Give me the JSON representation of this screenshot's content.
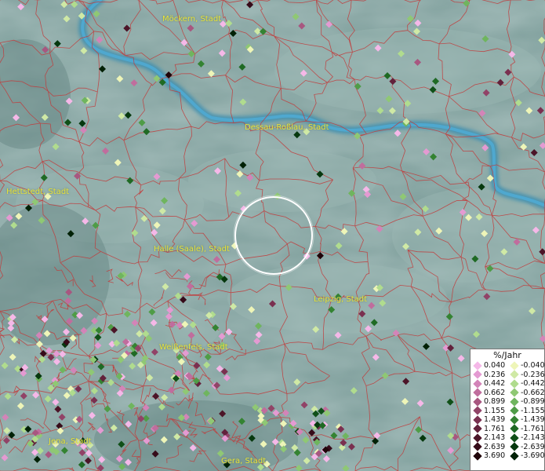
{
  "map": {
    "cities": [
      "Möckern, Stadt",
      "Dessau-Roßlau, Stadt",
      "Hettstedt, Stadt",
      "Halle (Saale), Stadt",
      "Leipzig, Stadt",
      "Weißenfels, Stadt",
      "Jena, Stadt",
      "Gera, Stadt"
    ],
    "legend": {
      "title": "%/Jahr",
      "positive": [
        {
          "label": "0.040",
          "color": "#f5b8e8"
        },
        {
          "label": "0.236",
          "color": "#e49ad2"
        },
        {
          "label": "0.442",
          "color": "#d384b8"
        },
        {
          "label": "0.662",
          "color": "#c06d9d"
        },
        {
          "label": "0.899",
          "color": "#a85780"
        },
        {
          "label": "1.155",
          "color": "#914367"
        },
        {
          "label": "1.439",
          "color": "#7a3050"
        },
        {
          "label": "1.761",
          "color": "#62213b"
        },
        {
          "label": "2.143",
          "color": "#4c1528"
        },
        {
          "label": "2.639",
          "color": "#360b19"
        },
        {
          "label": "3.690",
          "color": "#1f0409"
        }
      ],
      "negative": [
        {
          "label": "-0.040",
          "color": "#eef5b8"
        },
        {
          "label": "-0.236",
          "color": "#cfe9a5"
        },
        {
          "label": "-0.442",
          "color": "#b0dc8e"
        },
        {
          "label": "-0.662",
          "color": "#8fc874"
        },
        {
          "label": "-0.899",
          "color": "#6fb55e"
        },
        {
          "label": "-1.155",
          "color": "#4f9c47"
        },
        {
          "label": "-1.439",
          "color": "#348332"
        },
        {
          "label": "-1.761",
          "color": "#1f6a24"
        },
        {
          "label": "-2.143",
          "color": "#105018"
        },
        {
          "label": "-2.639",
          "color": "#06380e"
        },
        {
          "label": "-3.690",
          "color": "#012106"
        }
      ]
    },
    "colors": {
      "background": "#7f9f9c",
      "river": "#3d8fb0",
      "borders": "#c23a3a",
      "labels": "#e8e23a",
      "selection_ring": "#ffffff"
    }
  }
}
